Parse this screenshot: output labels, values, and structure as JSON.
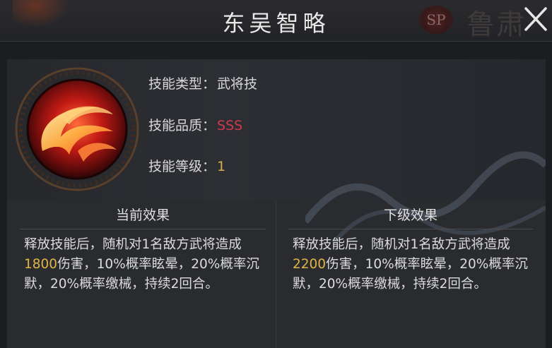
{
  "header": {
    "title": "东吴智略",
    "badge": "SP",
    "bg_name": "鲁肃"
  },
  "skill": {
    "type_label": "技能类型：",
    "type_value": "武将技",
    "quality_label": "技能品质：",
    "quality_value": "SSS",
    "level_label": "技能等级：",
    "level_value": "1"
  },
  "current": {
    "heading": "当前效果",
    "text_before": "释放技能后，随机对1名敌方武将造成",
    "damage": "1800",
    "text_after": "伤害，10%概率眩晕，20%概率沉默，20%概率缴械，持续2回合。"
  },
  "next": {
    "heading": "下级效果",
    "text_before": "释放技能后，随机对1名敌方武将造成",
    "damage": "2200",
    "text_after": "伤害，10%概率眩晕，20%概率沉默，20%概率缴械，持续2回合。"
  },
  "colors": {
    "quality": "#d23a4c",
    "damage": "#e0b545",
    "level": "#d9b14c"
  },
  "icons": {
    "skill": "fire-swirl-icon",
    "close": "close-icon"
  }
}
